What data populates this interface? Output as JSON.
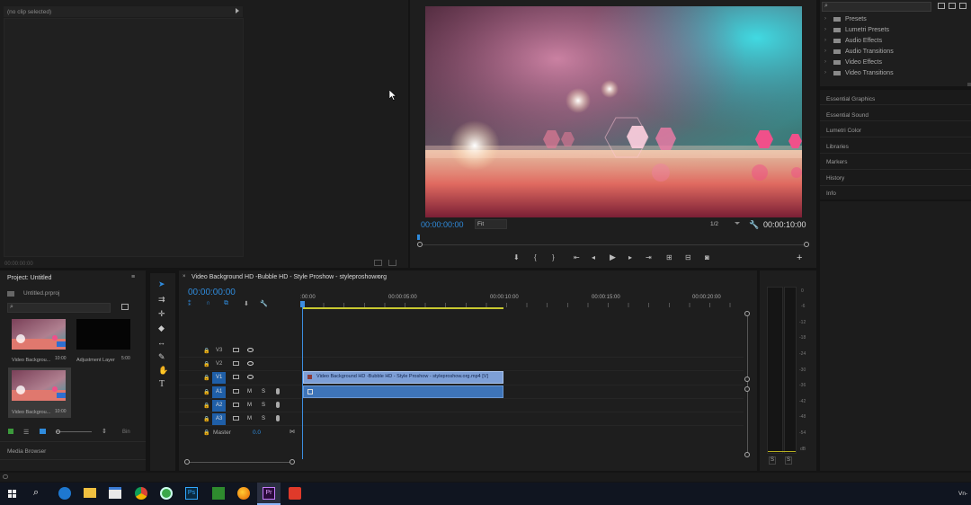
{
  "source_monitor": {
    "no_clip_label": "(no clip selected)",
    "timecode": "00:00:00:00"
  },
  "program_monitor": {
    "timecode_current": "00:00:00:00",
    "fit_label": "Fit",
    "resolution_label": "1/2",
    "timecode_end": "00:00:10:00"
  },
  "effects_panel": {
    "items": [
      "Presets",
      "Lumetri Presets",
      "Audio Effects",
      "Audio Transitions",
      "Video Effects",
      "Video Transitions"
    ]
  },
  "side_panels": {
    "items": [
      "Essential Graphics",
      "Essential Sound",
      "Lumetri Color",
      "Libraries",
      "Markers",
      "History",
      "Info"
    ]
  },
  "project": {
    "title": "Project: Untitled",
    "file": "Untitled.prproj",
    "items": [
      {
        "name": "Video Backgrou...",
        "duration": "10:00"
      },
      {
        "name": "Adjustment Layer",
        "duration": "5:00"
      },
      {
        "name": "Video Backgrou...",
        "duration": "10:00"
      }
    ],
    "bin_label": "Bin",
    "media_browser": "Media Browser"
  },
  "timeline": {
    "title": "Video Background HD -Bubble HD - Style Proshow - styleproshow.org",
    "timecode": "00:00:00:00",
    "ruler": [
      ":00:00",
      "00:00:05:00",
      "00:00:10:00",
      "00:00:15:00",
      "00:00:20:00"
    ],
    "video_tracks": [
      "V3",
      "V2",
      "V1"
    ],
    "audio_tracks": [
      "A1",
      "A2",
      "A3"
    ],
    "master_label": "Master",
    "master_value": "0.0",
    "clip_label": "Video Background HD -Bubble HD - Style Proshow - styleproshow.org.mp4 [V]",
    "mute": "M",
    "solo": "S"
  },
  "audio_meter": {
    "scale": [
      "0",
      "-6",
      "-12",
      "-18",
      "-24",
      "-30",
      "-36",
      "-42",
      "-48",
      "-54",
      "dB"
    ],
    "solo_left": "S",
    "solo_right": "S"
  },
  "taskbar": {
    "right_text": "Vn-"
  }
}
